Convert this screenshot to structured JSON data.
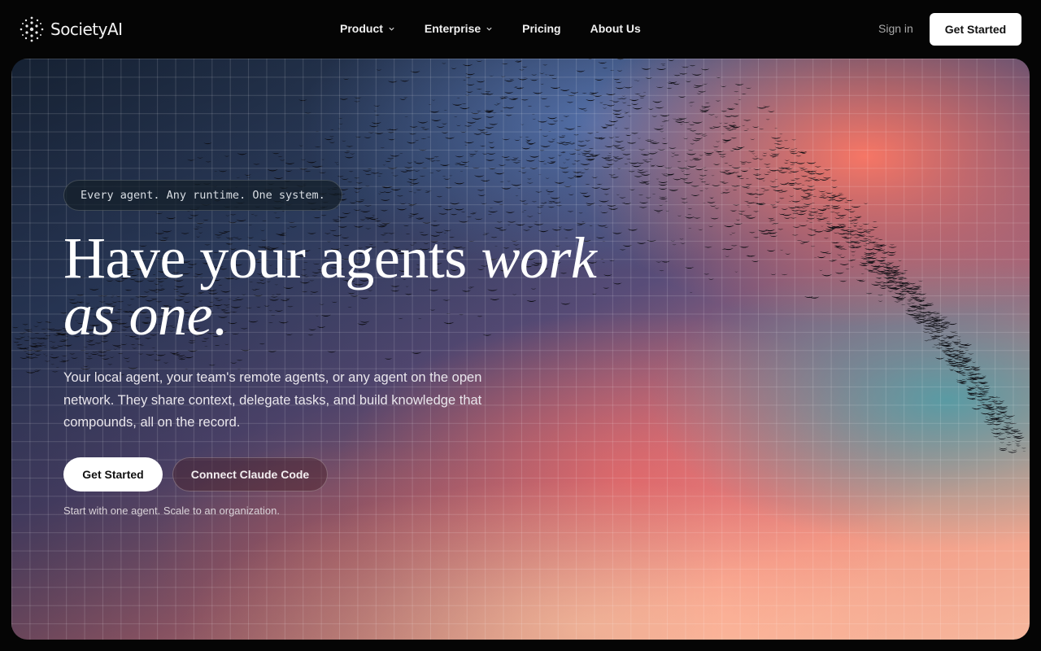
{
  "nav": {
    "brand": "SocietyAI",
    "links": [
      {
        "label": "Product",
        "has_dropdown": true
      },
      {
        "label": "Enterprise",
        "has_dropdown": true
      },
      {
        "label": "Pricing",
        "has_dropdown": false
      },
      {
        "label": "About Us",
        "has_dropdown": false
      }
    ],
    "sign_in": "Sign in",
    "cta": "Get Started"
  },
  "hero": {
    "tagline": "Every agent. Any runtime. One system.",
    "headline_plain": "Have your agents ",
    "headline_italic_1": "work",
    "headline_italic_2": "as one",
    "headline_end": ".",
    "subtitle": "Your local agent, your team's remote agents, or any agent on the open network. They share context, delegate tasks, and build knowledge that compounds, all on the record.",
    "primary_button": "Get Started",
    "secondary_button": "Connect Claude Code",
    "note": "Start with one agent. Scale to an organization."
  },
  "icons": [
    "logo-mark-icon",
    "chevron-down-icon"
  ],
  "colors": {
    "page_background": "#050505",
    "primary_button_bg": "#ffffff",
    "primary_button_text": "#111111",
    "accent_coral": "#f29b86",
    "accent_teal": "#46a0aa"
  }
}
